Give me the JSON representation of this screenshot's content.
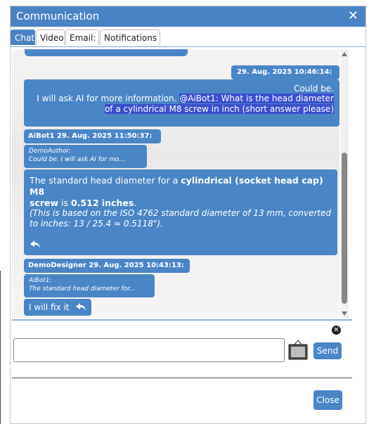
{
  "window": {
    "title": "Communication",
    "close_glyph": "✕"
  },
  "tabs": [
    {
      "label": "Chat",
      "active": true
    },
    {
      "label": "Video",
      "active": false
    },
    {
      "label": "Email:",
      "active": false
    },
    {
      "label": "Notifications",
      "active": false
    }
  ],
  "messages": {
    "own_header": "29. Aug. 2025 10:46:14:",
    "own_line1": "Could be.",
    "own_line2_plain": "I will ask AI for more information. ",
    "own_line2_mention": "@AiBot1: What is the head diameter",
    "own_line3_mention": "of a cylindrical M8 screw in inch (short answer please)",
    "ai_header": "AiBot1 29. Aug. 2025 11:50:37:",
    "ai_quote_author": "DemoAuthor:",
    "ai_quote_text": "Could be. I will ask AI for mo...",
    "ai_body_1": "The standard head diameter for a ",
    "ai_body_bold": "cylindrical (socket head cap) M8",
    "ai_body_2_bold": "screw",
    "ai_body_2": " is ",
    "ai_body_value": "0.512 inches",
    "ai_body_end": ".",
    "ai_note_line1": "(This is based on the ISO 4762 standard diameter of 13 mm, converted",
    "ai_note_line2": "to inches: 13 / 25.4 ≈ 0.5118\").",
    "dd_header": "DemoDesigner 29. Aug. 2025 10:43:13:",
    "dd_quote_author": "AiBot1:",
    "dd_quote_text": "The standard head diameter for...",
    "dd_body": "I will fix it"
  },
  "compose": {
    "input_value": "",
    "send_label": "Send",
    "clear_glyph": "✕"
  },
  "footer": {
    "close_label": "Close"
  },
  "colors": {
    "accent": "#4a86c6",
    "titlebar": "#4a83c4",
    "mention_highlight": "#3b4fcf"
  },
  "icons": [
    "close-icon",
    "reply-icon",
    "image-icon",
    "scroll-up-icon",
    "scroll-down-icon",
    "clear-icon"
  ]
}
